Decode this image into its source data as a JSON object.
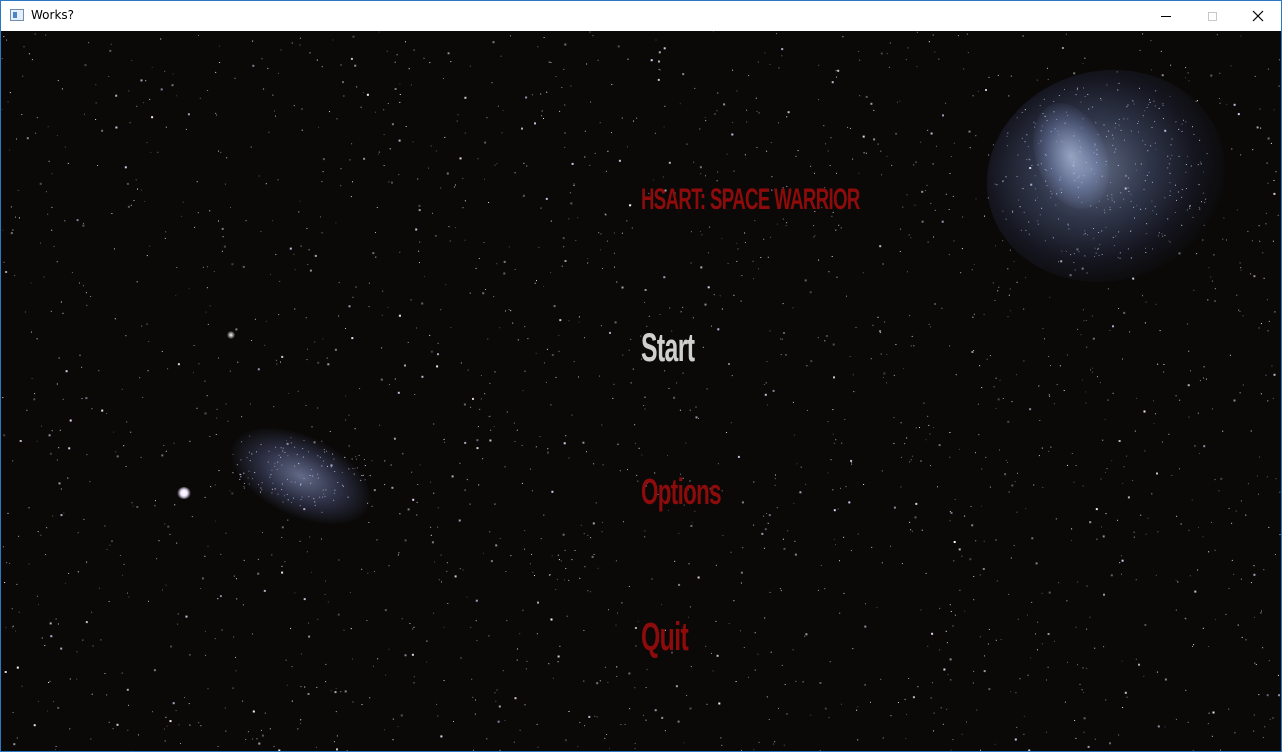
{
  "window": {
    "title": "Works?",
    "controls": {
      "minimize_icon": "minimize-icon",
      "maximize_icon": "maximize-icon",
      "close_icon": "close-icon"
    }
  },
  "menu": {
    "title": "HSART: SPACE WARRIOR",
    "items": [
      {
        "label": "Start",
        "state": "highlighted"
      },
      {
        "label": "Options",
        "state": "normal"
      },
      {
        "label": "Quit",
        "state": "normal"
      }
    ]
  },
  "colors": {
    "title": "#8e0b0b",
    "highlighted_item": "#cfcfcf",
    "normal_item": "#8e0b0b",
    "background": "#0a0908",
    "window_border": "#2b78c5"
  }
}
